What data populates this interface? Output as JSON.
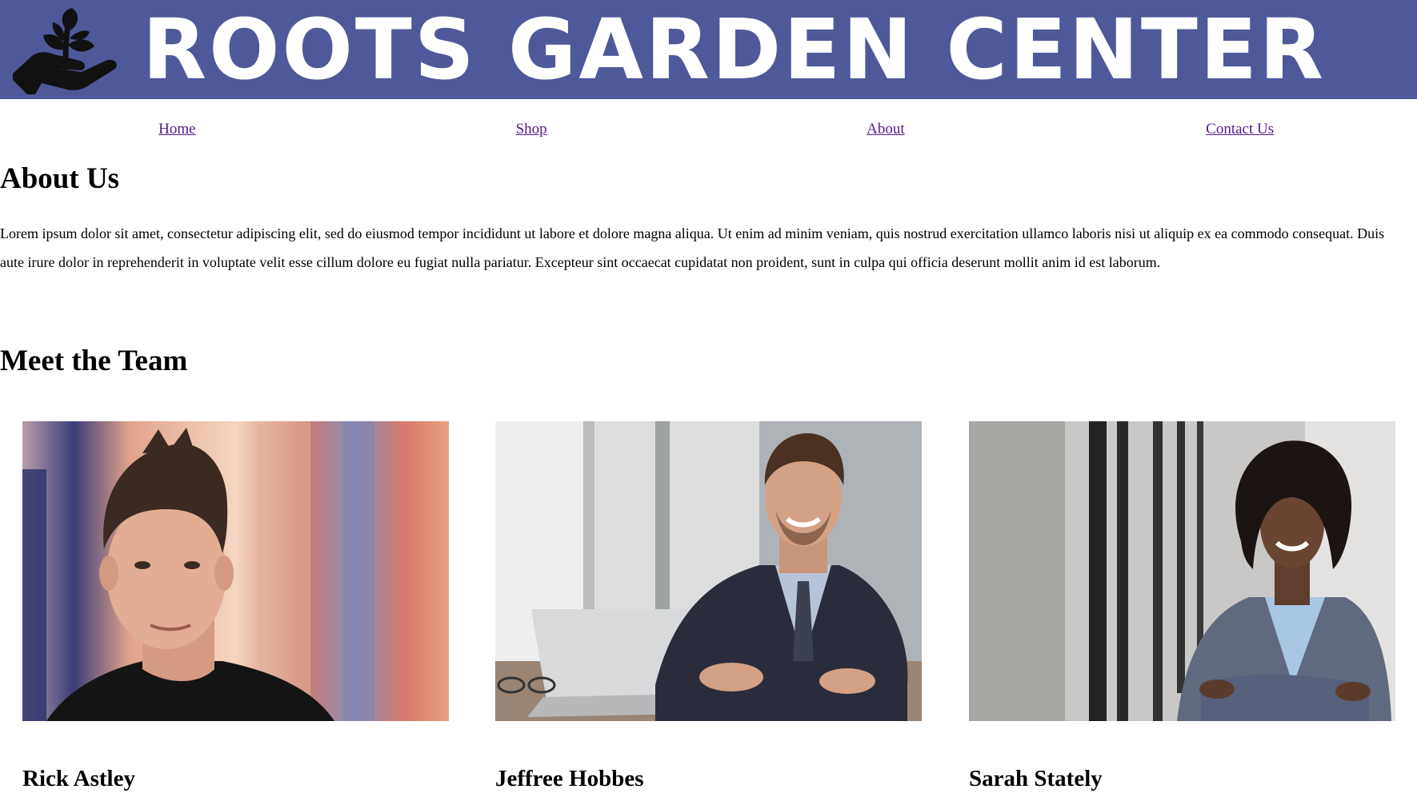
{
  "header": {
    "title": "ROOTS GARDEN CENTER",
    "logo_icon": "hand-holding-plant-icon",
    "background_color": "#4f5899"
  },
  "nav": {
    "items": [
      {
        "label": "Home"
      },
      {
        "label": "Shop"
      },
      {
        "label": "About"
      },
      {
        "label": "Contact Us"
      }
    ],
    "link_color": "#551a8b"
  },
  "about": {
    "heading": "About Us",
    "paragraph": "Lorem ipsum dolor sit amet, consectetur adipiscing elit, sed do eiusmod tempor incididunt ut labore et dolore magna aliqua. Ut enim ad minim veniam, quis nostrud exercitation ullamco laboris nisi ut aliquip ex ea commodo consequat. Duis aute irure dolor in reprehenderit in voluptate velit esse cillum dolore eu fugiat nulla pariatur. Excepteur sint occaecat cupidatat non proident, sunt in culpa qui officia deserunt mollit anim id est laborum."
  },
  "team": {
    "heading": "Meet the Team",
    "members": [
      {
        "name": "Rick Astley"
      },
      {
        "name": "Jeffree Hobbes"
      },
      {
        "name": "Sarah Stately"
      }
    ]
  }
}
